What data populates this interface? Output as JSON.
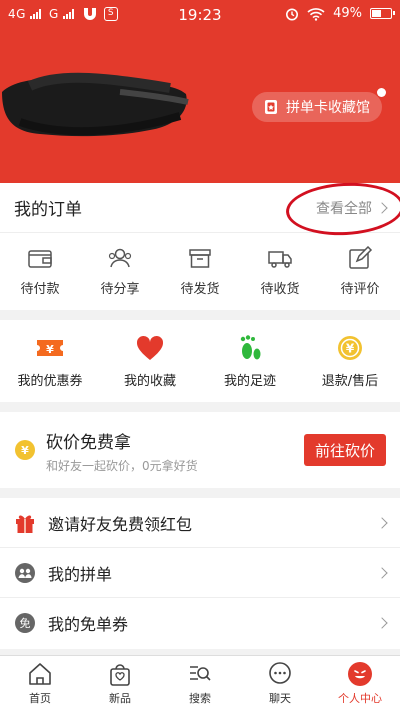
{
  "status_bar": {
    "network_left": "4G",
    "network_right": "G",
    "app_badge": "S",
    "time": "19:23",
    "battery": "49%",
    "battery_level": 0.49
  },
  "header": {
    "album_button": "拼单卡收藏馆"
  },
  "orders": {
    "title": "我的订单",
    "view_all": "查看全部",
    "items": [
      {
        "label": "待付款",
        "icon": "wallet-icon"
      },
      {
        "label": "待分享",
        "icon": "users-icon"
      },
      {
        "label": "待发货",
        "icon": "box-icon"
      },
      {
        "label": "待收货",
        "icon": "truck-icon"
      },
      {
        "label": "待评价",
        "icon": "edit-icon"
      }
    ]
  },
  "quick_links": [
    {
      "label": "我的优惠券",
      "icon": "coupon-icon"
    },
    {
      "label": "我的收藏",
      "icon": "heart-icon"
    },
    {
      "label": "我的足迹",
      "icon": "footprint-icon"
    },
    {
      "label": "退款/售后",
      "icon": "refund-coin-icon"
    }
  ],
  "bargain": {
    "title": "砍价免费拿",
    "subtitle": "和好友一起砍价，0元拿好货",
    "button": "前往砍价",
    "coin_glyph": "¥"
  },
  "list": [
    {
      "label": "邀请好友免费领红包",
      "icon": "gift-icon"
    },
    {
      "label": "我的拼单",
      "icon": "group-icon"
    },
    {
      "label": "我的免单券",
      "icon": "free-coupon-icon",
      "glyph": "免"
    }
  ],
  "tabbar": [
    {
      "label": "首页",
      "icon": "home-icon"
    },
    {
      "label": "新品",
      "icon": "bag-icon"
    },
    {
      "label": "搜索",
      "icon": "search-icon"
    },
    {
      "label": "聊天",
      "icon": "chat-icon"
    },
    {
      "label": "个人中心",
      "icon": "profile-icon",
      "active": true
    }
  ],
  "colors": {
    "brand_red": "#e33a2c",
    "footprint_green": "#2fb83c",
    "coin_yellow": "#f2c230",
    "coupon_orange": "#f46a1f",
    "annotation_circle": "#d21020"
  }
}
